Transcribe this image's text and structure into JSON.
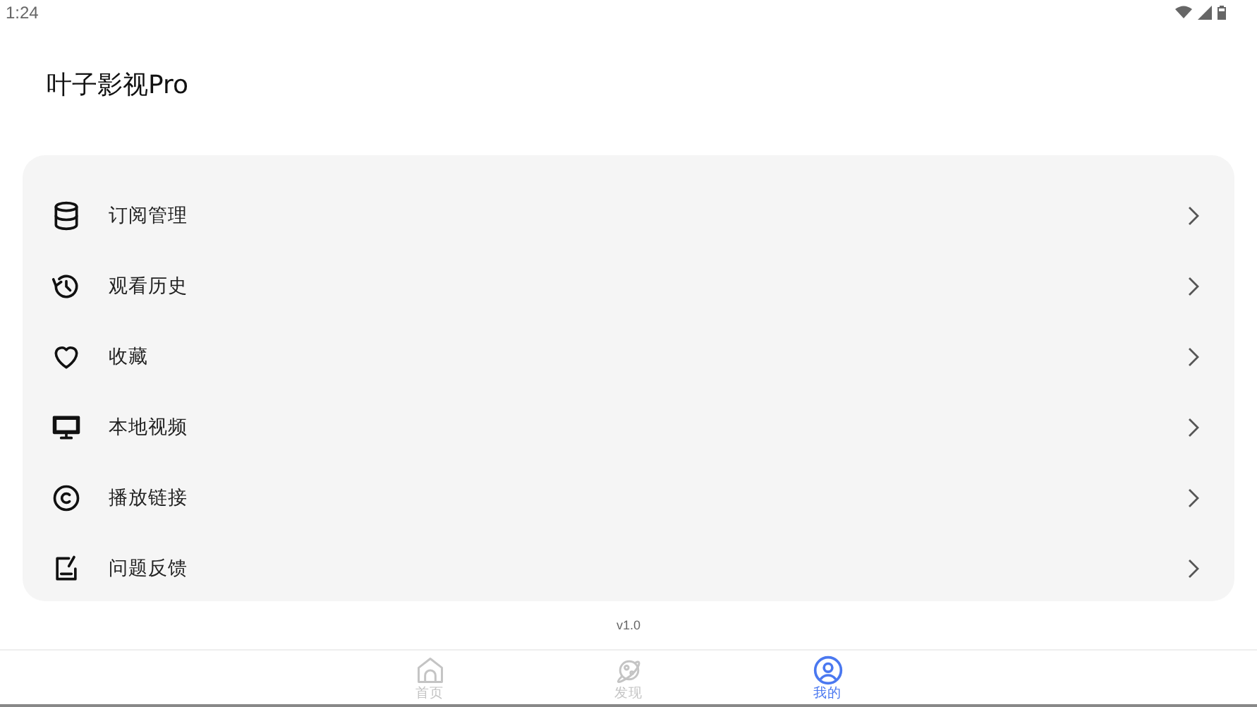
{
  "status_bar": {
    "time": "1:24"
  },
  "app_title": "叶子影视Pro",
  "menu_items": [
    {
      "label": "订阅管理"
    },
    {
      "label": "观看历史"
    },
    {
      "label": "收藏"
    },
    {
      "label": "本地视频"
    },
    {
      "label": "播放链接"
    },
    {
      "label": "问题反馈"
    }
  ],
  "version": "v1.0",
  "tabs": [
    {
      "label": "首页",
      "selected": false
    },
    {
      "label": "发现",
      "selected": false
    },
    {
      "label": "我的",
      "selected": true
    }
  ]
}
